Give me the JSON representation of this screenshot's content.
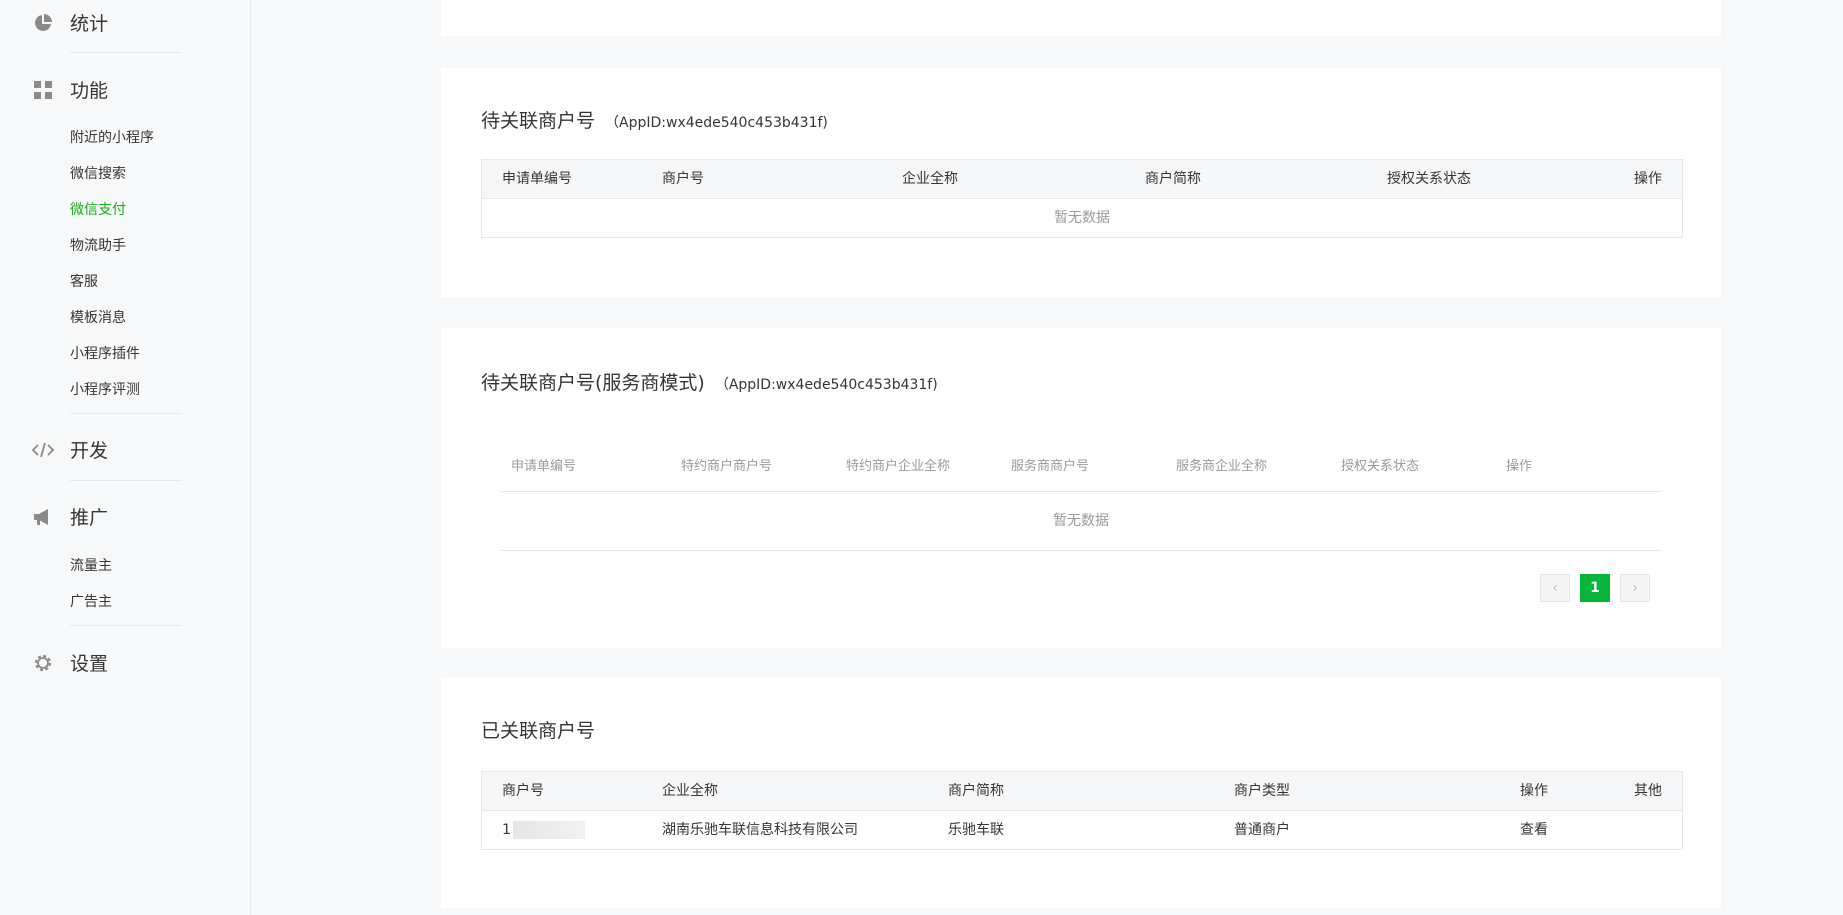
{
  "sidebar": {
    "stats_label": "统计",
    "features_label": "功能",
    "feature_items": [
      "附近的小程序",
      "微信搜索",
      "微信支付",
      "物流助手",
      "客服",
      "模板消息",
      "小程序插件",
      "小程序评测"
    ],
    "dev_label": "开发",
    "promo_label": "推广",
    "promo_items": [
      "流量主",
      "广告主"
    ],
    "settings_label": "设置",
    "active_item": "微信支付",
    "accent_color": "#1aad19"
  },
  "pending": {
    "title": "待关联商户号",
    "appid": "（AppID:wx4ede540c453b431f)",
    "columns": [
      "申请单编号",
      "商户号",
      "企业全称",
      "商户简称",
      "授权关系状态",
      "操作"
    ],
    "empty_text": "暂无数据"
  },
  "pending_sp": {
    "title": "待关联商户号(服务商模式)",
    "appid": "（AppID:wx4ede540c453b431f)",
    "columns": [
      "申请单编号",
      "特约商户商户号",
      "特约商户企业全称",
      "服务商商户号",
      "服务商企业全称",
      "授权关系状态",
      "操作"
    ],
    "empty_text": "暂无数据",
    "pagination": {
      "prev": "‹",
      "current": "1",
      "next": "›"
    }
  },
  "linked": {
    "title": "已关联商户号",
    "columns": [
      "商户号",
      "企业全称",
      "商户简称",
      "商户类型",
      "操作",
      "其他"
    ],
    "rows": [
      {
        "merchant_no": "1",
        "company": "湖南乐驰车联信息科技有限公司",
        "short_name": "乐驰车联",
        "type": "普通商户",
        "action": "查看",
        "other": ""
      }
    ]
  }
}
